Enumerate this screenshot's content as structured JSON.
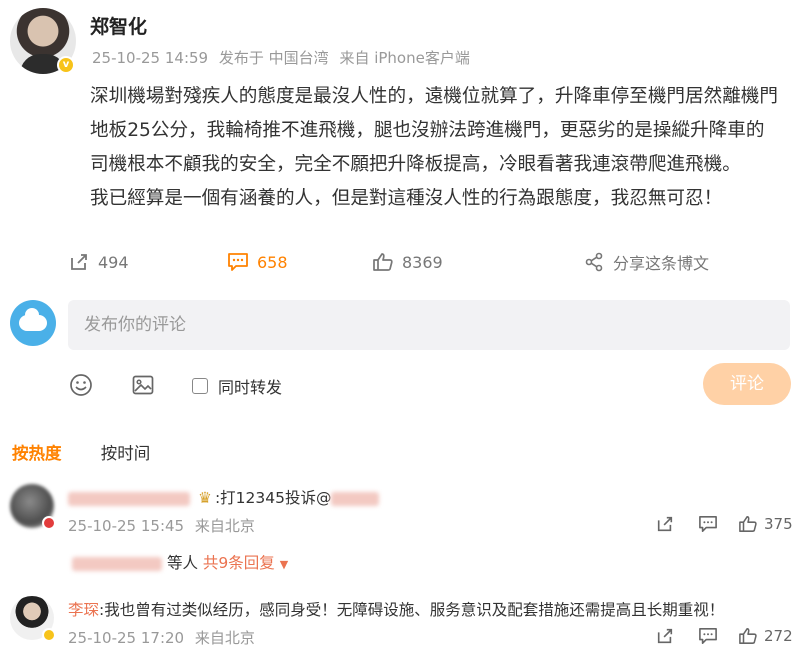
{
  "post": {
    "author": "郑智化",
    "time": "25-10-25 14:59",
    "location": "发布于 中国台湾",
    "source": "来自 iPhone客户端",
    "content_line1": "深圳機場對殘疾人的態度是最沒人性的，遠機位就算了，升降車停至機門居然離機門地板25公分，我輪椅推不進飛機，腿也沒辦法跨進機門，更惡劣的是操縱升降車的司機根本不顧我的安全，完全不願把升降板提高，冷眼看著我連滾帶爬進飛機。",
    "content_line2": "我已經算是一個有涵養的人，但是對這種沒人性的行為跟態度，我忍無可忍！",
    "verified_badge": "v",
    "icons": {
      "avatar": "author-avatar-photo",
      "badge": "verified-badge-icon"
    }
  },
  "actions": {
    "repost_count": "494",
    "comment_count": "658",
    "like_count": "8369",
    "share_label": "分享这条博文",
    "accent_color": "#ff8200"
  },
  "composer": {
    "placeholder": "发布你的评论",
    "repost_label": "同时转发",
    "submit_label": "评论"
  },
  "sort": {
    "hot": "按热度",
    "time": "按时间"
  },
  "comments": [
    {
      "text": ":打12345投诉@",
      "time": "25-10-25 15:45",
      "source": "来自北京",
      "like_count": "375",
      "replies_prefix": "等人",
      "replies_more": "共9条回复"
    },
    {
      "name": "李琛",
      "text": ":我也曾有过类似经历，感同身受！无障碍设施、服务意识及配套措施还需提高且长期重视！",
      "time": "25-10-25 17:20",
      "source": "来自北京",
      "like_count": "272"
    }
  ]
}
